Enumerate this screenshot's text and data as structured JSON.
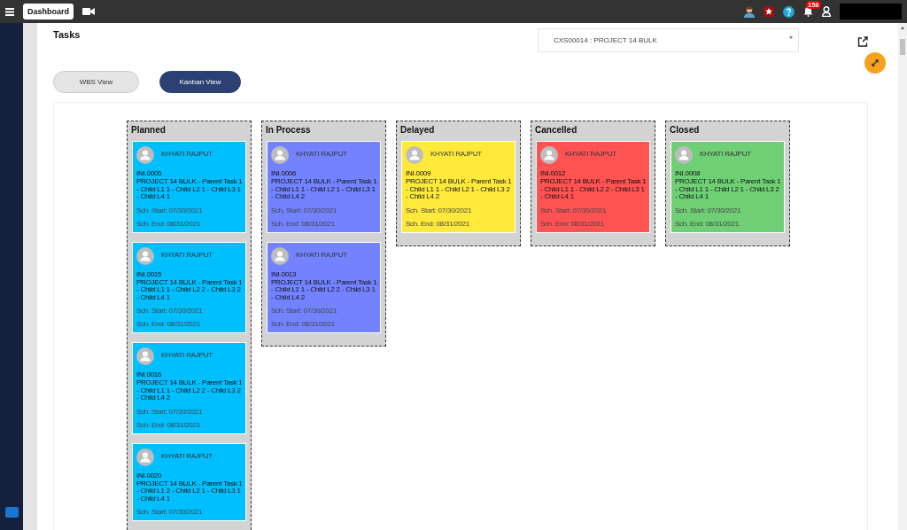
{
  "topbar": {
    "dashboard_button": "Dashboard",
    "notification_count": "158"
  },
  "page": {
    "title": "Tasks",
    "project_select": "CXS00014 : PROJECT 14 BULK"
  },
  "view_tabs": [
    {
      "label": "WBS View",
      "selected": false
    },
    {
      "label": "Kanban View",
      "selected": true
    }
  ],
  "columns": [
    {
      "title": "Planned",
      "color": "#00bfff",
      "cards": [
        {
          "assignee": "KHYATI RAJPUT",
          "id": "INI.0005",
          "name": "PROJECT 14 BULK - Parent Task 1 - Child L1 1 - Child L2 1 - Child L3 1 - Child L4 1",
          "start": "Sch. Start: 07/30/2021",
          "end": "Sch. End: 08/31/2021"
        },
        {
          "assignee": "KHYATI RAJPUT",
          "id": "INI.0015",
          "name": "PROJECT 14 BULK - Parent Task 1 - Child L1 1 - Child L2 2 - Child L3 2 - Child L4 1",
          "start": "Sch. Start: 07/30/2021",
          "end": "Sch. End: 08/31/2021"
        },
        {
          "assignee": "KHYATI RAJPUT",
          "id": "INI.0016",
          "name": "PROJECT 14 BULK - Parent Task 1 - Child L1 1 - Child L2 2 - Child L3 2 - Child L4 2",
          "start": "Sch. Start: 07/30/2021",
          "end": "Sch. End: 08/31/2021"
        },
        {
          "assignee": "KHYATI RAJPUT",
          "id": "INI.0020",
          "name": "PROJECT 14 BULK - Parent Task 1 - Child L1 2 - Child L2 1 - Child L3 1 - Child L4 1",
          "start": "Sch. Start: 07/30/2021"
        }
      ]
    },
    {
      "title": "In Process",
      "color": "#7383ff",
      "cards": [
        {
          "assignee": "KHYATI RAJPUT",
          "id": "INI.0006",
          "name": "PROJECT 14 BULK - Parent Task 1 - Child L1 1 - Child L2 1 - Child L3 1 - Child L4 2",
          "start": "Sch. Start: 07/30/2021",
          "end": "Sch. End: 08/31/2021"
        },
        {
          "assignee": "KHYATI RAJPUT",
          "id": "INI.0013",
          "name": "PROJECT 14 BULK - Parent Task 1 - Child L1 1 - Child L2 2 - Child L3 1 - Child L4 2",
          "start": "Sch. Start: 07/30/2021",
          "end": "Sch. End: 08/31/2021"
        }
      ]
    },
    {
      "title": "Delayed",
      "color": "#ffea3b",
      "cards": [
        {
          "assignee": "KHYATI RAJPUT",
          "id": "INI.0009",
          "name": "PROJECT 14 BULK - Parent Task 1 - Child L1 1 - Child L2 1 - Child L3 2 - Child L4 2",
          "start": "Sch. Start: 07/30/2021",
          "end": "Sch. End: 08/31/2021"
        }
      ]
    },
    {
      "title": "Cancelled",
      "color": "#ff5252",
      "cards": [
        {
          "assignee": "KHYATI RAJPUT",
          "id": "INI.0012",
          "name": "PROJECT 14 BULK - Parent Task 1 - Child L1 1 - Child L2 2 - Child L3 1 - Child L4 1",
          "start": "Sch. Start: 07/30/2021",
          "end": "Sch. End: 08/31/2021"
        }
      ]
    },
    {
      "title": "Closed",
      "color": "#6fcf75",
      "cards": [
        {
          "assignee": "KHYATI RAJPUT",
          "id": "INI.0008",
          "name": "PROJECT 14 BULK - Parent Task 1 - Child L1 1 - Child L2 1 - Child L3 2 - Child L4 1",
          "start": "Sch. Start: 07/30/2021",
          "end": "Sch. End: 08/31/2021"
        }
      ]
    }
  ]
}
